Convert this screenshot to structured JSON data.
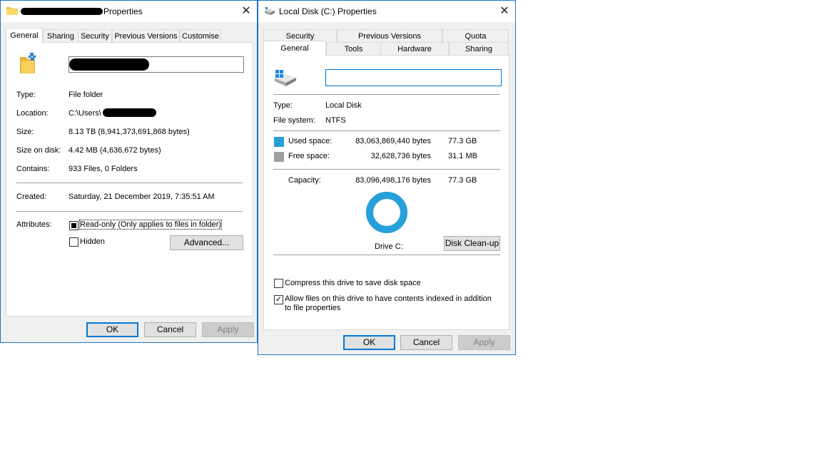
{
  "left_window": {
    "title_suffix": "Properties",
    "close_glyph": "✕",
    "tabs": [
      "General",
      "Sharing",
      "Security",
      "Previous Versions",
      "Customise"
    ],
    "name_value": "",
    "rows": [
      {
        "label": "Type:",
        "value": "File folder"
      },
      {
        "label": "Location:",
        "value": "C:\\Users\\"
      },
      {
        "label": "Size:",
        "value": "8.13 TB (8,941,373,691,868 bytes)"
      },
      {
        "label": "Size on disk:",
        "value": "4.42 MB (4,636,672 bytes)"
      },
      {
        "label": "Contains:",
        "value": "933 Files, 0 Folders"
      },
      {
        "label": "Created:",
        "value": "Saturday, 21 December 2019, 7:35:51 AM"
      }
    ],
    "attributes_label": "Attributes:",
    "readonly_label": "Read-only (Only applies to files in folder)",
    "readonly_state": "indeterminate",
    "hidden_label": "Hidden",
    "hidden_checked": false,
    "advanced_label": "Advanced...",
    "ok_label": "OK",
    "cancel_label": "Cancel",
    "apply_label": "Apply"
  },
  "right_window": {
    "title": "Local Disk (C:) Properties",
    "close_glyph": "✕",
    "tabs_row1": [
      "Security",
      "Previous Versions",
      "Quota"
    ],
    "tabs_row2": [
      "General",
      "Tools",
      "Hardware",
      "Sharing"
    ],
    "name_value": "",
    "type_label": "Type:",
    "type_value": "Local Disk",
    "fs_label": "File system:",
    "fs_value": "NTFS",
    "used_label": "Used space:",
    "used_bytes": "83,063,869,440 bytes",
    "used_gb": "77.3 GB",
    "free_label": "Free space:",
    "free_bytes": "32,628,736 bytes",
    "free_gb": "31.1 MB",
    "capacity_label": "Capacity:",
    "capacity_bytes": "83,096,498,176 bytes",
    "capacity_gb": "77.3 GB",
    "used_fraction": 0.9996,
    "drive_label": "Drive C:",
    "cleanup_label": "Disk Clean-up",
    "compress_label": "Compress this drive to save disk space",
    "compress_checked": false,
    "index_label": "Allow files on this drive to have contents indexed in addition to file properties",
    "index_checked": true,
    "ok_label": "OK",
    "cancel_label": "Cancel",
    "apply_label": "Apply"
  },
  "colors": {
    "used": "#26a0da",
    "free": "#a0a0a0",
    "accent": "#0078d7"
  }
}
